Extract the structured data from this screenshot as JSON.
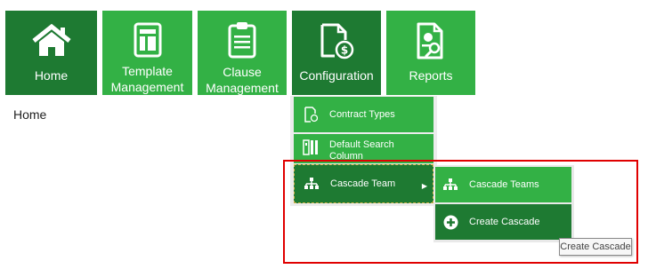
{
  "nav": {
    "home": {
      "label": "Home",
      "icon": "home-icon"
    },
    "template": {
      "label": "Template Management",
      "icon": "template-doc-icon"
    },
    "clause": {
      "label": "Clause Management",
      "icon": "clipboard-icon"
    },
    "configuration": {
      "label": "Configuration",
      "icon": "document-dollar-icon"
    },
    "reports": {
      "label": "Reports",
      "icon": "report-search-icon"
    }
  },
  "breadcrumb": "Home",
  "config_menu": {
    "items": [
      {
        "label": "Contract Types",
        "icon": "contract-doc-icon"
      },
      {
        "label": "Default Search Column",
        "icon": "columns-icon"
      },
      {
        "label": "Cascade Team",
        "icon": "org-chart-icon",
        "submenu_indicator": "▶"
      }
    ]
  },
  "cascade_submenu": {
    "items": [
      {
        "label": "Cascade Teams",
        "icon": "org-chart-icon"
      },
      {
        "label": "Create Cascade",
        "icon": "plus-circle-icon"
      }
    ]
  },
  "tooltip": "Create Cascade",
  "colors": {
    "tile_green": "#33b145",
    "tile_dark_green": "#1e7a32",
    "highlight_red": "#e00000"
  }
}
